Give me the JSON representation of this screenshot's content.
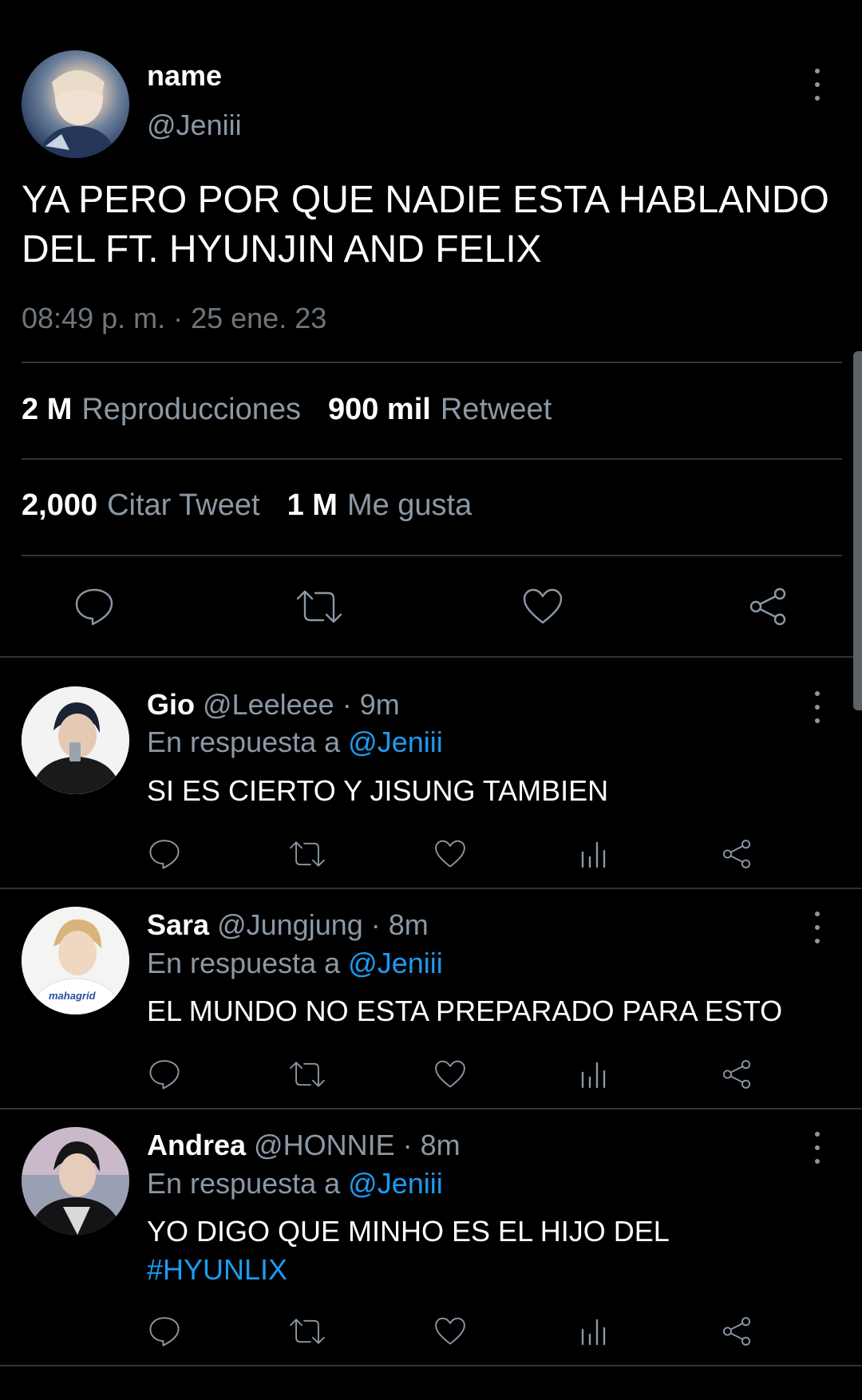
{
  "main_tweet": {
    "name": "name",
    "handle": "@Jeniii",
    "text_line1": "YA PERO POR QUE NADIE ESTA HABLANDO",
    "text_line2": "DEL FT. HYUNJIN AND FELIX",
    "timestamp": "08:49 p. m. · 25 ene. 23",
    "stats": {
      "views_count": "2 M",
      "views_label": "Reproducciones",
      "retweets_count": "900 mil",
      "retweets_label": "Retweet",
      "quotes_count": "2,000",
      "quotes_label": "Citar Tweet",
      "likes_count": "1 M",
      "likes_label": "Me gusta"
    }
  },
  "replies": [
    {
      "name": "Gio",
      "handle": "@Leeleee",
      "time": "· 9m",
      "reply_prefix": "En respuesta a",
      "reply_to": "@Jeniii",
      "text": "SI ES CIERTO Y JISUNG TAMBIEN",
      "hashtag": ""
    },
    {
      "name": "Sara",
      "handle": "@Jungjung",
      "time": "· 8m",
      "reply_prefix": "En respuesta a",
      "reply_to": "@Jeniii",
      "text": "EL MUNDO NO ESTA PREPARADO PARA ESTO",
      "hashtag": ""
    },
    {
      "name": "Andrea",
      "handle": "@HONNIE",
      "time": "· 8m",
      "reply_prefix": "En respuesta a",
      "reply_to": "@Jeniii",
      "text": "YO DIGO QUE MINHO ES EL HIJO DEL",
      "hashtag": "#HYUNLIX",
      "avatar_text": ""
    }
  ],
  "avatar_logo_text": "mahagrid",
  "icons": {
    "reply": "comment-icon",
    "retweet": "retweet-icon",
    "like": "heart-icon",
    "views": "analytics-icon",
    "share": "share-icon",
    "more": "more-vertical-icon"
  },
  "colors": {
    "background": "#000000",
    "accent": "#1d9bf0",
    "muted": "#8b98a5",
    "divider": "#2f3336"
  }
}
